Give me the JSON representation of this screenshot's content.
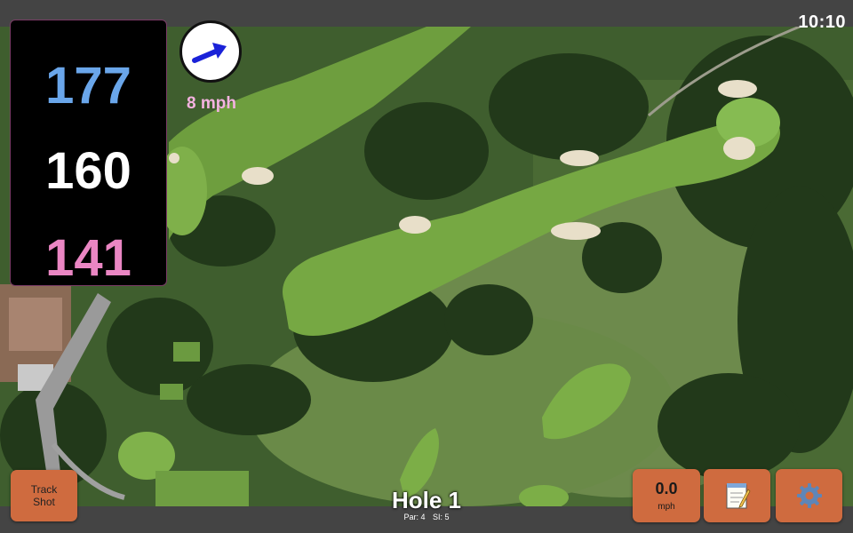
{
  "status": {
    "time": "10:10"
  },
  "distances": {
    "back": "177",
    "middle": "160",
    "front": "141"
  },
  "wind": {
    "speed": "8 mph",
    "icon": "wind-arrow-icon"
  },
  "hole": {
    "title": "Hole 1",
    "par": "Par: 4",
    "stroke_index": "SI: 5"
  },
  "buttons": {
    "track_shot_line1": "Track",
    "track_shot_line2": "Shot",
    "speed_value": "0.0",
    "speed_unit": "mph",
    "notes_icon": "notepad-icon",
    "settings_icon": "gear-icon"
  },
  "colors": {
    "back": "#6aa6ea",
    "middle": "#ffffff",
    "front": "#ea86c3",
    "button": "#cf6b3f",
    "wind_text": "#f4b2e0"
  }
}
